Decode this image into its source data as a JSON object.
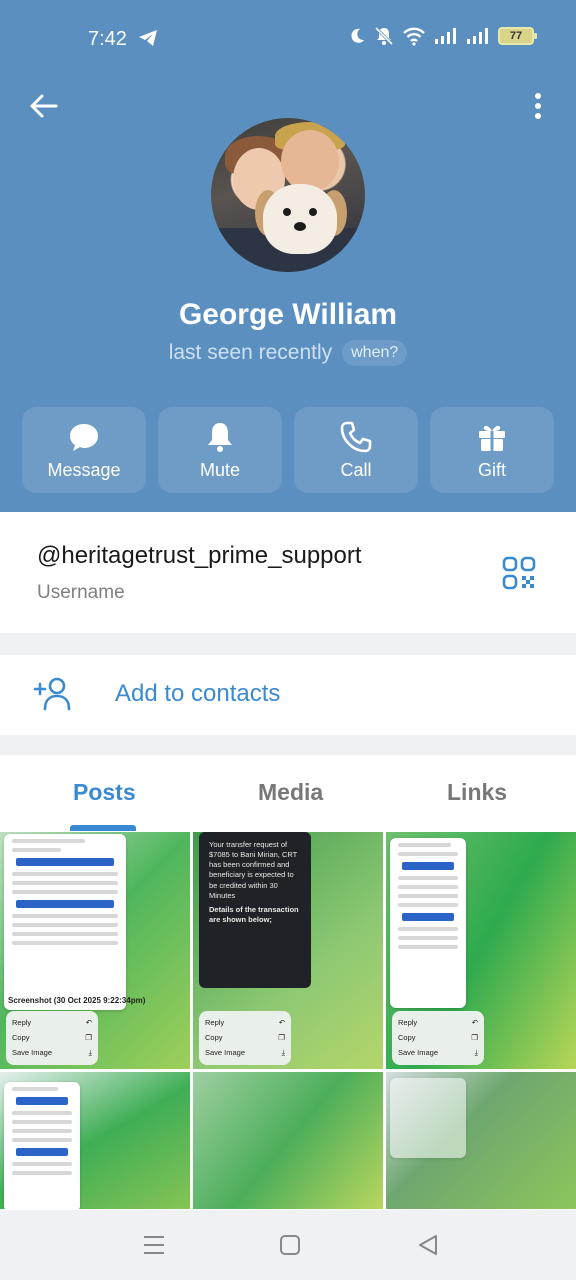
{
  "status_bar": {
    "time": "7:42",
    "battery": "77"
  },
  "profile": {
    "name": "George William",
    "last_seen": "last seen recently",
    "when_label": "when?"
  },
  "actions": [
    {
      "label": "Message",
      "icon": "message-bubble-icon"
    },
    {
      "label": "Mute",
      "icon": "bell-icon"
    },
    {
      "label": "Call",
      "icon": "phone-icon"
    },
    {
      "label": "Gift",
      "icon": "gift-icon"
    }
  ],
  "username": {
    "value": "@heritagetrust_prime_support",
    "label": "Username"
  },
  "add_contacts": {
    "label": "Add to contacts"
  },
  "tabs": [
    {
      "label": "Posts",
      "active": true
    },
    {
      "label": "Media",
      "active": false
    },
    {
      "label": "Links",
      "active": false
    }
  ],
  "media": {
    "caption_1": "Screenshot (30 Oct 2025 9:22:34pm)",
    "context_menu": [
      "Reply",
      "Copy",
      "Save Image"
    ],
    "dark_message": "Your transfer request of $7085 to Bani Mirian, CRT has been confirmed and beneficiary is expected to be credited within 30 Minutes",
    "dark_details_title": "Details of the transaction are shown below;"
  },
  "colors": {
    "header_bg": "#5a8fbf",
    "accent": "#3a8ad2",
    "action_bg": "#6f9cc6"
  }
}
